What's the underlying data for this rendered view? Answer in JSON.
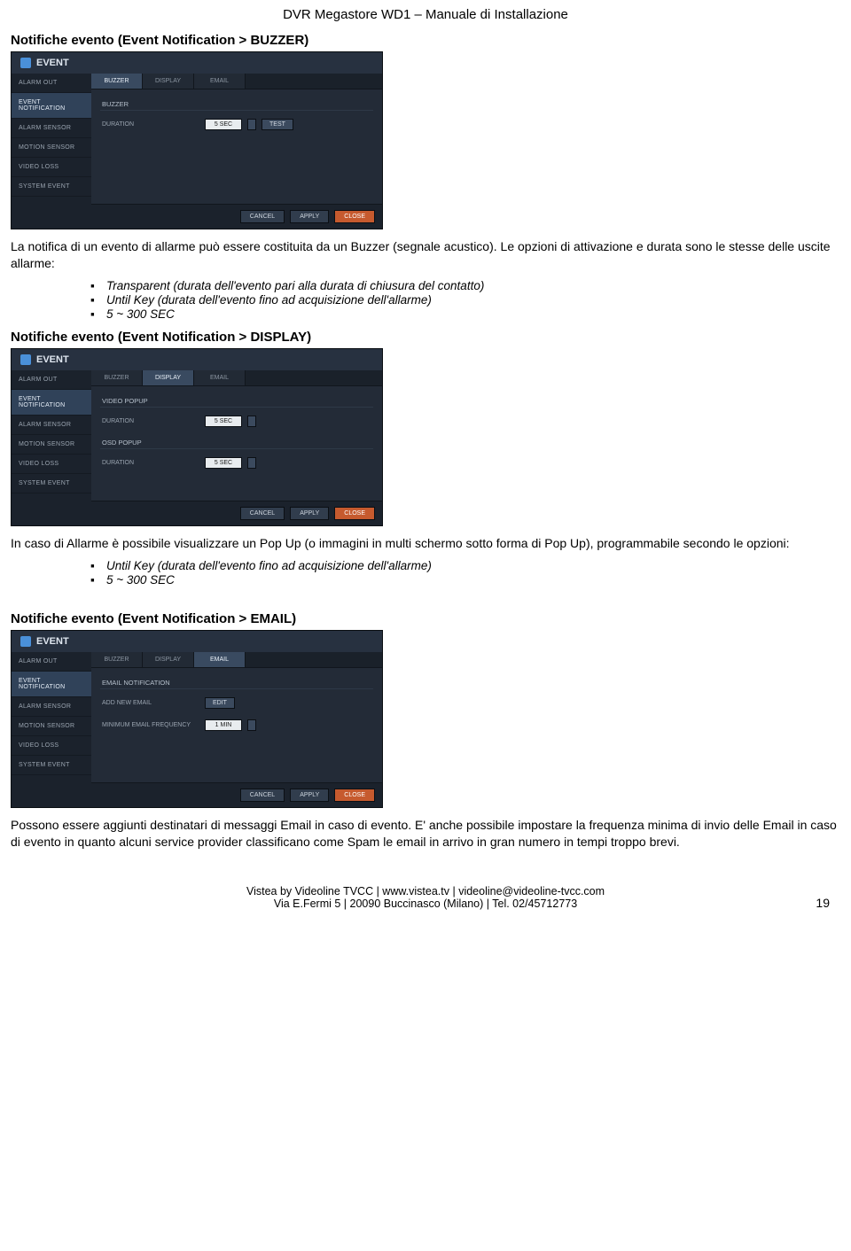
{
  "header": "DVR Megastore WD1 – Manuale di Installazione",
  "sec1_title": "Notifiche evento (Event Notification > BUZZER)",
  "sec1_para": "La notifica di un evento di allarme può essere costituita da un Buzzer (segnale acustico). Le opzioni di attivazione e durata sono le stesse delle uscite allarme:",
  "sec1_bullets": [
    "Transparent (durata dell'evento pari alla durata di chiusura del contatto)",
    "Until Key (durata dell'evento fino ad acquisizione dell'allarme)",
    "5 ~ 300 SEC"
  ],
  "sec2_title": "Notifiche evento (Event Notification > DISPLAY)",
  "sec2_para": "In caso di Allarme è possibile visualizzare un Pop Up (o immagini in multi schermo sotto forma di Pop Up), programmabile secondo le opzioni:",
  "sec2_bullets": [
    "Until Key (durata dell'evento fino ad acquisizione dell'allarme)",
    "5 ~ 300 SEC"
  ],
  "sec3_title": "Notifiche evento (Event Notification > EMAIL)",
  "sec3_para": "Possono essere aggiunti destinatari di messaggi Email in caso di evento. E' anche possibile impostare la frequenza minima di invio delle Email in caso di evento in quanto alcuni service provider classificano come Spam le email in arrivo in gran numero in tempi troppo brevi.",
  "footer_line1": "Vistea by Videoline TVCC | www.vistea.tv | videoline@videoline-tvcc.com",
  "footer_line2": "Via E.Fermi 5 | 20090 Buccinasco (Milano) | Tel. 02/45712773",
  "page_number": "19",
  "dvr": {
    "title": "EVENT",
    "nav": [
      "ALARM OUT",
      "EVENT NOTIFICATION",
      "ALARM SENSOR",
      "MOTION SENSOR",
      "VIDEO LOSS",
      "SYSTEM EVENT"
    ],
    "tabs": {
      "buzzer": "BUZZER",
      "display": "DISPLAY",
      "email": "EMAIL"
    },
    "buzzer": {
      "group": "BUZZER",
      "label": "DURATION",
      "value": "5 SEC",
      "test": "TEST"
    },
    "display": {
      "group1": "VIDEO POPUP",
      "label1": "DURATION",
      "value1": "5 SEC",
      "group2": "OSD POPUP",
      "label2": "DURATION",
      "value2": "5 SEC"
    },
    "email": {
      "group": "EMAIL NOTIFICATION",
      "label1": "ADD NEW EMAIL",
      "btn1": "EDIT",
      "label2": "MINIMUM EMAIL FREQUENCY",
      "value2": "1 MIN"
    },
    "footer": {
      "cancel": "CANCEL",
      "apply": "APPLY",
      "close": "CLOSE"
    }
  }
}
